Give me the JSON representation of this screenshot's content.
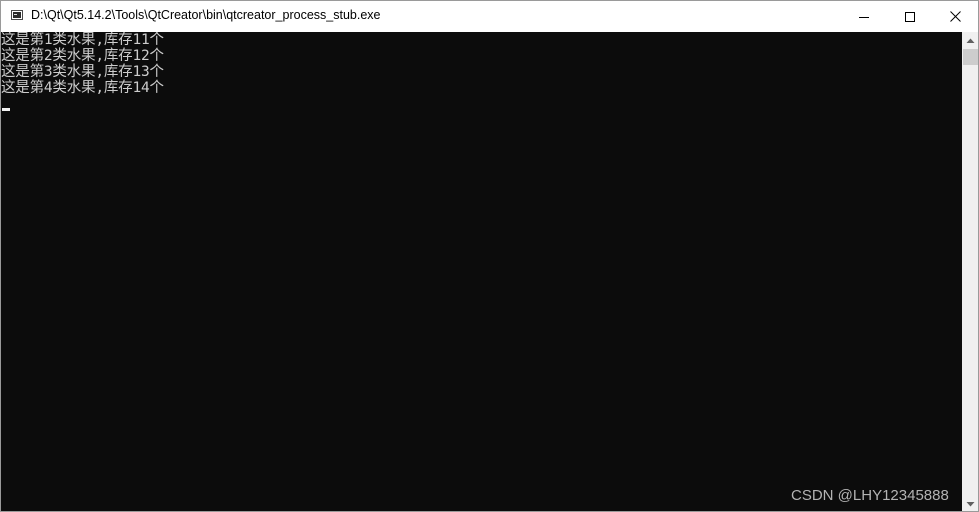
{
  "window": {
    "title": "D:\\Qt\\Qt5.14.2\\Tools\\QtCreator\\bin\\qtcreator_process_stub.exe",
    "app_icon": "console-window-icon",
    "buttons": {
      "minimize_icon": "minimize-icon",
      "maximize_icon": "maximize-icon",
      "close_icon": "close-icon"
    }
  },
  "console": {
    "lines": [
      "这是第1类水果,库存11个",
      "这是第2类水果,库存12个",
      "这是第3类水果,库存13个",
      "这是第4类水果,库存14个"
    ],
    "background_color": "#0c0c0c",
    "text_color": "#cccccc"
  },
  "scrollbar": {
    "up_icon": "scroll-up-arrow-icon",
    "down_icon": "scroll-down-arrow-icon"
  },
  "watermark": "CSDN @LHY12345888"
}
